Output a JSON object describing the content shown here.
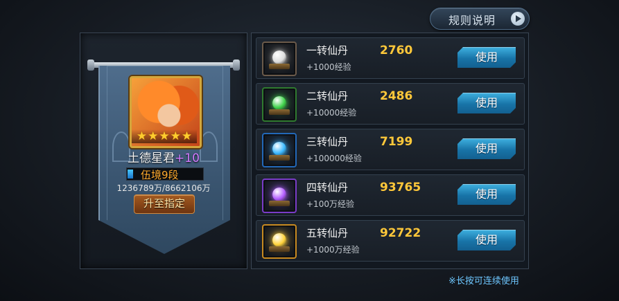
{
  "header": {
    "rules_label": "规则说明"
  },
  "hero": {
    "name": "土德星君",
    "plus": "+10",
    "stars": 5,
    "realm": "伍境9段",
    "realm_progress": 0.07,
    "exp_text": "1236789万/8662106万",
    "promote_label": "升至指定"
  },
  "pills": [
    {
      "name": "一转仙丹",
      "exp": "+1000经验",
      "qty": "2760",
      "orb_color": "#dcdcdc",
      "frame_color": "#6b5a4a",
      "button": "使用"
    },
    {
      "name": "二转仙丹",
      "exp": "+10000经验",
      "qty": "2486",
      "orb_color": "#3fd24a",
      "frame_color": "#2f7a2f",
      "button": "使用"
    },
    {
      "name": "三转仙丹",
      "exp": "+100000经验",
      "qty": "7199",
      "orb_color": "#3ab8ff",
      "frame_color": "#2268b8",
      "button": "使用"
    },
    {
      "name": "四转仙丹",
      "exp": "+100万经验",
      "qty": "93765",
      "orb_color": "#b25cff",
      "frame_color": "#7a3cc8",
      "button": "使用"
    },
    {
      "name": "五转仙丹",
      "exp": "+1000万经验",
      "qty": "92722",
      "orb_color": "#ffd23a",
      "frame_color": "#c88a20",
      "button": "使用"
    }
  ],
  "footer": {
    "hint": "※长按可连续使用"
  }
}
